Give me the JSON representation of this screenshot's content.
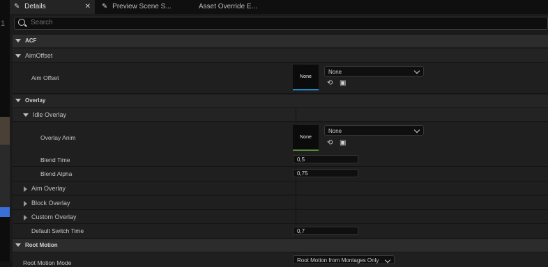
{
  "left_strip": {
    "number": "1"
  },
  "tabs": [
    {
      "label": "Details",
      "active": true
    },
    {
      "label": "Preview Scene S...",
      "active": false
    },
    {
      "label": "Asset Override E...",
      "active": false
    }
  ],
  "search": {
    "placeholder": "Search"
  },
  "categories": {
    "acf": "ACF",
    "overlay": "Overlay",
    "root_motion": "Root Motion"
  },
  "groups": {
    "aim_offset": "AimOffset",
    "idle_overlay": "Idle Overlay",
    "aim_overlay": "Aim Overlay",
    "block_overlay": "Block Overlay",
    "custom_overlay": "Custom Overlay"
  },
  "props": {
    "aim_offset": {
      "label": "Aim Offset",
      "thumb": "None",
      "value": "None"
    },
    "overlay_anim": {
      "label": "Overlay Anim",
      "thumb": "None",
      "value": "None"
    },
    "blend_time": {
      "label": "Blend Time",
      "value": "0,5"
    },
    "blend_alpha": {
      "label": "Blend Alpha",
      "value": "0,75"
    },
    "default_switch_time": {
      "label": "Default Switch Time",
      "value": "0,7"
    },
    "root_motion_mode": {
      "label": "Root Motion Mode",
      "value": "Root Motion from Montages Only"
    }
  },
  "icons": [
    "pencil-icon",
    "close-icon",
    "search-icon",
    "browse-arrow-icon",
    "folder-search-icon",
    "chevron-down-icon"
  ],
  "colors": {
    "accent_blue": "#1e88c8",
    "accent_green": "#5a8a3a"
  }
}
